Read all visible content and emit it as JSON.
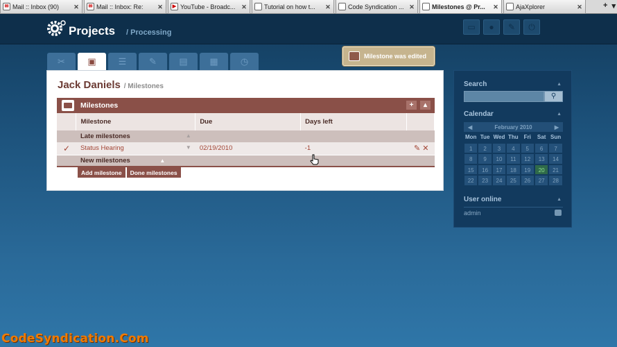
{
  "browser": {
    "tabs": [
      {
        "title": "Mail :: Inbox (90)",
        "icon": "mail-icon"
      },
      {
        "title": "Mail :: Inbox: Re:",
        "icon": "mail-icon"
      },
      {
        "title": "YouTube - Broadc...",
        "icon": "youtube-icon"
      },
      {
        "title": "Tutorial on how t...",
        "icon": "page-icon"
      },
      {
        "title": "Code Syndication ...",
        "icon": "page-icon"
      },
      {
        "title": "Milestones @ Pr...",
        "icon": "project-icon",
        "active": true
      },
      {
        "title": "AjaXplorer",
        "icon": "page-icon"
      }
    ]
  },
  "header": {
    "title": "Projects",
    "subtitle": "/ Processing"
  },
  "notification": {
    "text": "Milestone was edited"
  },
  "page": {
    "name": "Jack Daniels",
    "section": "/ Milestones"
  },
  "milestones": {
    "panel_title": "Milestones",
    "columns": [
      "Milestone",
      "Due",
      "Days left"
    ],
    "late_group": "Late milestones",
    "new_group": "New milestones",
    "rows": [
      {
        "name": "Status Hearing",
        "due": "02/19/2010",
        "days_left": "-1"
      }
    ],
    "add_button": "Add milestone",
    "done_button": "Done milestones"
  },
  "sidebar": {
    "search_title": "Search",
    "calendar_title": "Calendar",
    "month": "February 2010",
    "weekdays": [
      "Mon",
      "Tue",
      "Wed",
      "Thu",
      "Fri",
      "Sat",
      "Sun"
    ],
    "days": [
      "1",
      "2",
      "3",
      "4",
      "5",
      "6",
      "7",
      "8",
      "9",
      "10",
      "11",
      "12",
      "13",
      "14",
      "15",
      "16",
      "17",
      "18",
      "19",
      "20",
      "21",
      "22",
      "23",
      "24",
      "25",
      "26",
      "27",
      "28"
    ],
    "today": "20",
    "users_title": "User online",
    "users": [
      "admin"
    ]
  },
  "watermark": "CodeSyndication.Com",
  "colors": {
    "brand": "#8a5048",
    "header_bg": "#0e2f4b",
    "notification": "#c6b48e",
    "watermark": "#f07a00"
  }
}
